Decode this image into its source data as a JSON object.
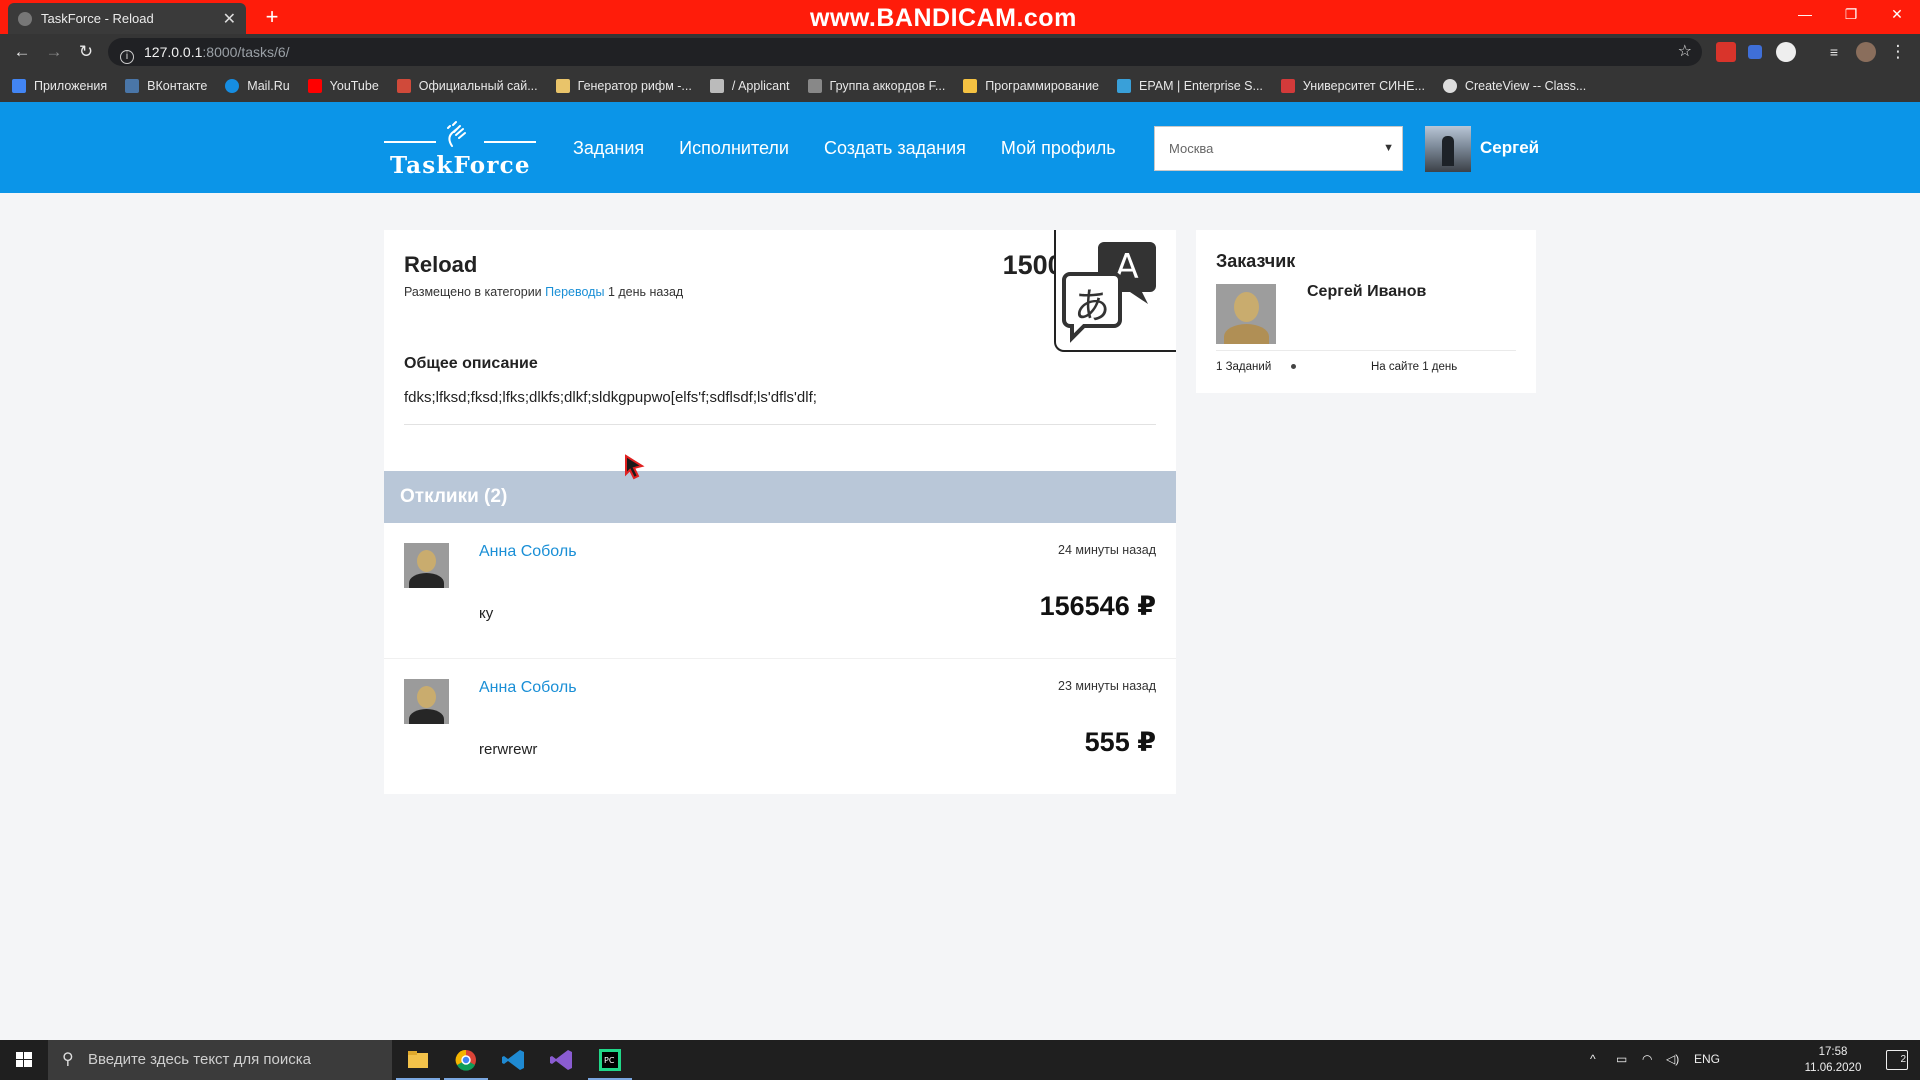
{
  "browser": {
    "tab_title": "TaskForce - Reload",
    "url_host": "127.0.0.1",
    "url_path": ":8000/tasks/6/",
    "watermark": "www.BANDICAM.com",
    "bookmarks": [
      {
        "label": "Приложения",
        "icon": "apps-grid-icon",
        "color": "#4285f4"
      },
      {
        "label": "ВКонтакте",
        "icon": "vk-icon",
        "color": "#4a76a8"
      },
      {
        "label": "Mail.Ru",
        "icon": "mailru-icon",
        "color": "#168de2"
      },
      {
        "label": "YouTube",
        "icon": "youtube-icon",
        "color": "#ff0000"
      },
      {
        "label": "Официальный сай...",
        "icon": "site-icon",
        "color": "#d04a3a"
      },
      {
        "label": "Генератор рифм -...",
        "icon": "pen-icon",
        "color": "#e9c46a"
      },
      {
        "label": "/ Applicant",
        "icon": "applicant-icon",
        "color": "#bbbbbb"
      },
      {
        "label": "Группа аккордов F...",
        "icon": "guitar-icon",
        "color": "#888888"
      },
      {
        "label": "Программирование",
        "icon": "folder-icon",
        "color": "#f5c242"
      },
      {
        "label": "EPAM | Enterprise S...",
        "icon": "epam-icon",
        "color": "#39a0d9"
      },
      {
        "label": "Университет СИНЕ...",
        "icon": "university-icon",
        "color": "#d33a3a"
      },
      {
        "label": "CreateView -- Class...",
        "icon": "globe-icon",
        "color": "#dddddd"
      }
    ]
  },
  "header": {
    "logo_text": "TaskForce",
    "nav": [
      "Задания",
      "Исполнители",
      "Создать задания",
      "Мой профиль"
    ],
    "city_selected": "Москва",
    "user_name": "Сергей"
  },
  "task": {
    "title": "Reload",
    "meta_prefix": "Размещено в категории",
    "category": "Переводы",
    "posted_ago": "1 день назад",
    "price": "15000 ₽",
    "category_icon": "translate-icon",
    "description_title": "Общее описание",
    "description": "fdks;lfksd;fksd;lfks;dlkfs;dlkf;sldkgpupwo[elfs'f;sdflsdf;ls'dfls'dlf;"
  },
  "responses": {
    "title": "Отклики (2)",
    "items": [
      {
        "name": "Анна Соболь",
        "time": "24 минуты назад",
        "message": "ку",
        "amount": "156546 ₽"
      },
      {
        "name": "Анна Соболь",
        "time": "23 минуты назад",
        "message": "rerwrewr",
        "amount": "555 ₽"
      }
    ]
  },
  "customer": {
    "title": "Заказчик",
    "name": "Сергей Иванов",
    "tasks_count": "1 Заданий",
    "on_site": "На сайте 1 день"
  },
  "taskbar": {
    "search_placeholder": "Введите здесь текст для поиска",
    "lang": "ENG",
    "time": "17:58",
    "date": "11.06.2020",
    "notifications": "2"
  },
  "colors": {
    "header_bg": "#0b95e8",
    "link": "#1a8fd6",
    "responses_bar": "#b9c7d8"
  }
}
